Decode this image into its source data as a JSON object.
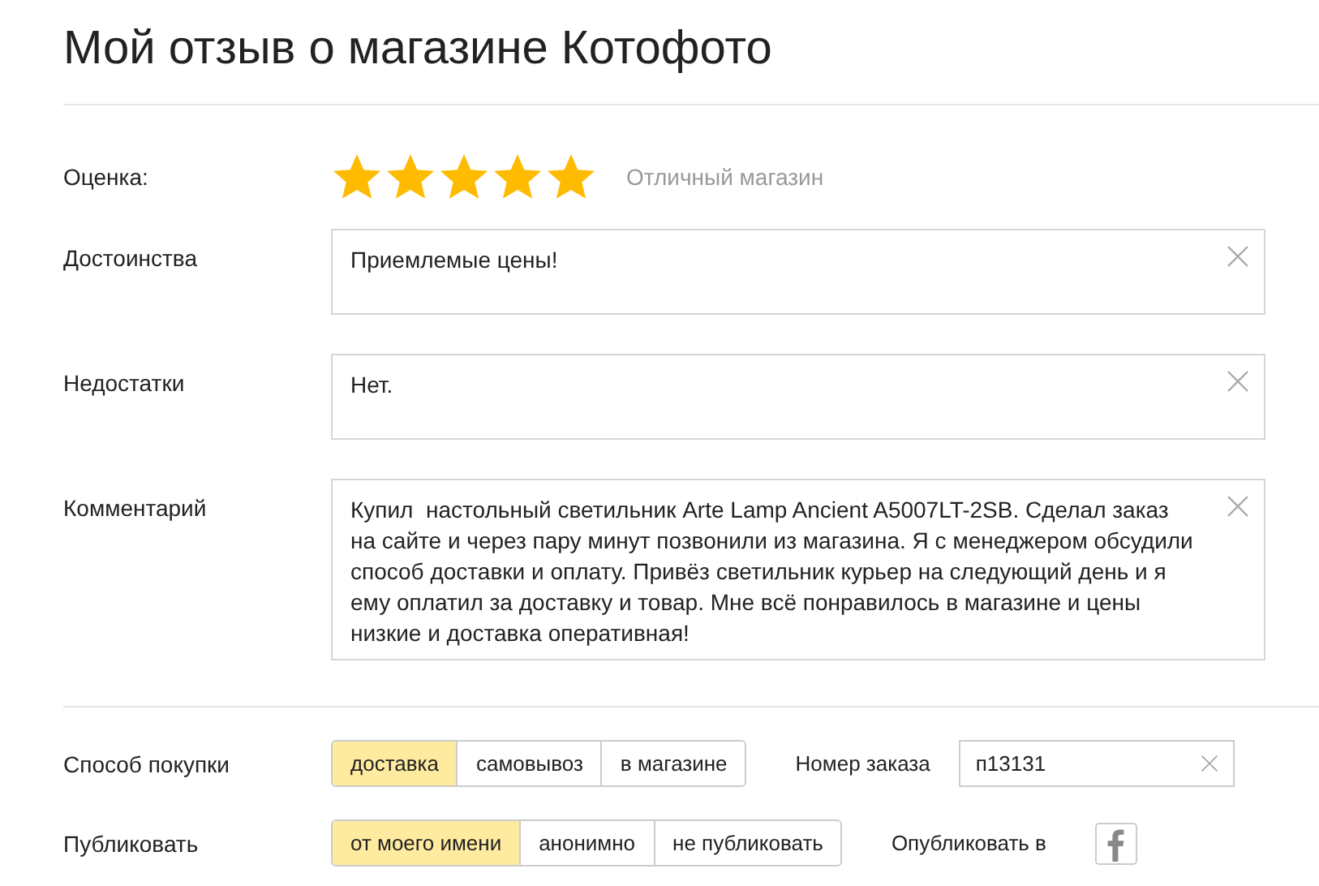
{
  "title": "Мой отзыв о магазине Котофото",
  "rating": {
    "label": "Оценка:",
    "stars": 5,
    "caption": "Отличный магазин"
  },
  "fields": [
    {
      "label": "Достоинства",
      "value": "Приемлемые цены!",
      "kind": "short"
    },
    {
      "label": "Недостатки",
      "value": "Нет.",
      "kind": "short"
    },
    {
      "label": "Комментарий",
      "value": "Купил  настольный светильник Arte Lamp Ancient A5007LT-2SB. Сделал заказ на сайте и через пару минут позвонили из магазина. Я с менеджером обсудили способ доставки и оплату. Привёз светильник курьер на следующий день и я ему оплатил за доставку и товар. Мне всё понравилось в магазине и цены низкие и доставка оперативная!",
      "kind": "long"
    }
  ],
  "purchase": {
    "label": "Способ покупки",
    "options": [
      {
        "label": "доставка",
        "selected": true
      },
      {
        "label": "самовывоз",
        "selected": false
      },
      {
        "label": "в магазине",
        "selected": false
      }
    ],
    "order_label": "Номер заказа",
    "order_value": "п13131"
  },
  "publish": {
    "label": "Публиковать",
    "options": [
      {
        "label": "от моего имени",
        "selected": true
      },
      {
        "label": "анонимно",
        "selected": false
      },
      {
        "label": "не публиковать",
        "selected": false
      }
    ],
    "share_label": "Опубликовать в"
  }
}
